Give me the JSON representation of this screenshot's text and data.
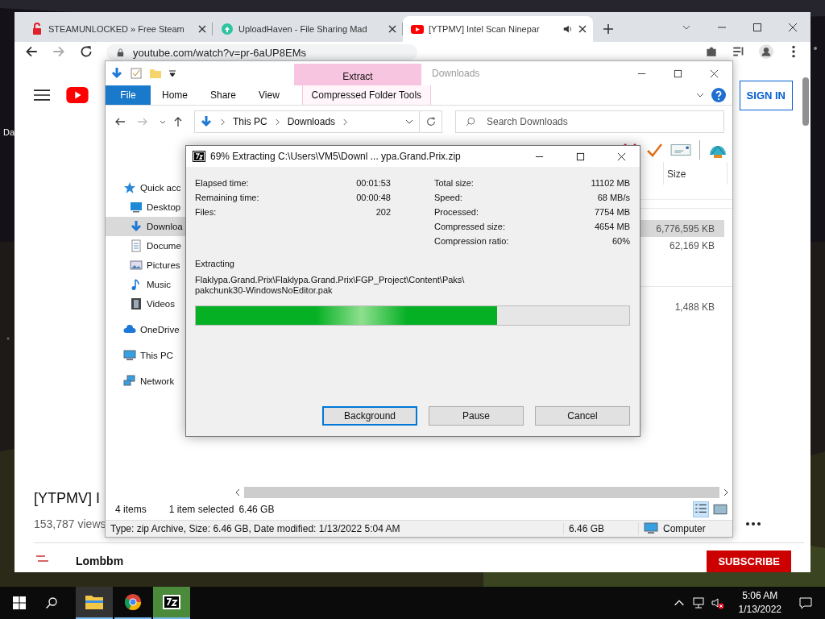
{
  "desktop": {
    "icon_label": "Da"
  },
  "browser": {
    "tabs": [
      {
        "title": "STEAMUNLOCKED » Free Steam",
        "selected": false,
        "kind": "lock",
        "audio": false
      },
      {
        "title": "UploadHaven - File Sharing Mad",
        "selected": false,
        "kind": "cloud",
        "audio": false
      },
      {
        "title": "[YTPMV] Intel Scan Ninepar",
        "selected": true,
        "kind": "play",
        "audio": true
      }
    ],
    "url": "youtube.com/watch?v=pr-6aUP8EMs",
    "page": {
      "sign_in": "SIGN IN",
      "video_title": "[YTPMV] I",
      "views": "153,787 views",
      "channel": "Lombbm",
      "subscribe": "SUBSCRIBE"
    }
  },
  "explorer": {
    "title": "Downloads",
    "context_tab": "Extract",
    "ribbon_tabs": [
      {
        "label": "File",
        "kind": "file"
      },
      {
        "label": "Home",
        "kind": "tab"
      },
      {
        "label": "Share",
        "kind": "tab"
      },
      {
        "label": "View",
        "kind": "tab"
      },
      {
        "label": "Compressed Folder Tools",
        "kind": "context"
      }
    ],
    "breadcrumb": [
      "This PC",
      "Downloads"
    ],
    "search_placeholder": "Search Downloads",
    "nav": [
      {
        "label": "Quick acc",
        "kind": "star",
        "selected": false
      },
      {
        "label": "Desktop",
        "kind": "desktop",
        "selected": false
      },
      {
        "label": "Downloa",
        "kind": "download",
        "selected": true
      },
      {
        "label": "Docume",
        "kind": "document",
        "selected": false
      },
      {
        "label": "Pictures",
        "kind": "picture",
        "selected": false
      },
      {
        "label": "Music",
        "kind": "music",
        "selected": false
      },
      {
        "label": "Videos",
        "kind": "video",
        "selected": false
      },
      {
        "label": "OneDrive",
        "kind": "cloud",
        "selected": false
      },
      {
        "label": "This PC",
        "kind": "pc",
        "selected": false
      },
      {
        "label": "Network",
        "kind": "network",
        "selected": false
      }
    ],
    "size_header": "Size",
    "groups": [
      {
        "rows": [
          {
            "size": "6,776,595 KB",
            "selected": true
          },
          {
            "size": "62,169 KB",
            "selected": false
          }
        ]
      },
      {
        "rows": [
          {
            "size": "1,488 KB",
            "selected": false
          }
        ]
      }
    ],
    "item_count": "4 items",
    "selection": "1 item selected",
    "selection_size": "6.46 GB",
    "details": "Type: zip Archive, Size: 6.46 GB, Date modified: 1/13/2022 5:04 AM",
    "details_size": "6.46 GB",
    "location": "Computer"
  },
  "dialog": {
    "title": "69% Extracting C:\\Users\\VM5\\Downl ... ypa.Grand.Prix.zip",
    "left_stats": [
      {
        "label": "Elapsed time:",
        "value": "00:01:53"
      },
      {
        "label": "Remaining time:",
        "value": "00:00:48"
      },
      {
        "label": "Files:",
        "value": "202"
      }
    ],
    "right_stats": [
      {
        "label": "Total size:",
        "value": "11102 MB"
      },
      {
        "label": "Speed:",
        "value": "68 MB/s"
      },
      {
        "label": "Processed:",
        "value": "7754 MB"
      },
      {
        "label": "Compressed size:",
        "value": "4654 MB"
      },
      {
        "label": "Compression ratio:",
        "value": "60%"
      }
    ],
    "status": "Extracting",
    "path": [
      "Flaklypa.Grand.Prix\\Flaklypa.Grand.Prix\\FGP_Project\\Content\\Paks\\",
      "pakchunk30-WindowsNoEditor.pak"
    ],
    "level": 0.696,
    "buttons": [
      {
        "label": "Background",
        "focused": true
      },
      {
        "label": "Pause",
        "focused": false
      },
      {
        "label": "Cancel",
        "focused": false
      }
    ]
  },
  "taskbar": {
    "apps": [
      {
        "kind": "explorer",
        "active": true
      },
      {
        "kind": "chrome",
        "active": false
      },
      {
        "kind": "sevenzip",
        "active": true
      }
    ],
    "time": "5:06 AM",
    "date": "1/13/2022"
  }
}
